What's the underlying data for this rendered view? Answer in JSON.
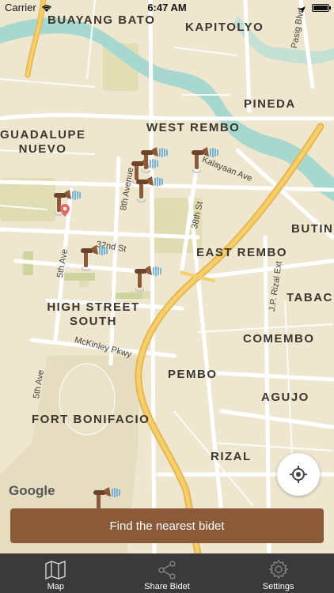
{
  "status_bar": {
    "carrier": "Carrier",
    "time": "6:47 AM"
  },
  "map": {
    "labels": {
      "buayang_bato": "BUAYANG BATO",
      "kapitolyo": "KAPITOLYO",
      "pineda": "PINEDA",
      "guadalupe": "GUADALUPE",
      "nuevo": "NUEVO",
      "west_rembo": "WEST REMBO",
      "east_rembo": "EAST REMBO",
      "butin": "BUTIN",
      "tabac": "TABAC",
      "high_street": "HIGH STREET",
      "south": "SOUTH",
      "comembo": "COMEMBO",
      "pembo": "PEMBO",
      "agujo": "AGUJO",
      "fort_bonifacio": "FORT BONIFACIO",
      "rizal": "RIZAL"
    },
    "streets": {
      "pasig_blvd": "Pasig Blvd",
      "kalayaan_ave": "Kalayaan Ave",
      "eighth_avenue": "8th Avenue",
      "thirty_eighth_st": "38th St",
      "thirty_second_st": "32nd St",
      "fifth_ave_top": "5th Ave",
      "fifth_ave_bottom": "5th Ave",
      "mckinley_pkwy": "McKinley Pkwy",
      "jp_rizal_ext": "J.P. Rizal Ext"
    },
    "attribution": "Google",
    "colors": {
      "land": "#efe6cf",
      "park": "#d9d9a8",
      "water": "#a7d8cf",
      "road": "#ffffff",
      "highway": "#f0c35a",
      "pin": "#8b5a38",
      "spray": "#5aa6d6"
    }
  },
  "primary_action": {
    "label": "Find the nearest bidet"
  },
  "tabs": [
    {
      "label": "Map",
      "icon": "map-icon"
    },
    {
      "label": "Share Bidet",
      "icon": "share-icon"
    },
    {
      "label": "Settings",
      "icon": "gear-icon"
    }
  ]
}
